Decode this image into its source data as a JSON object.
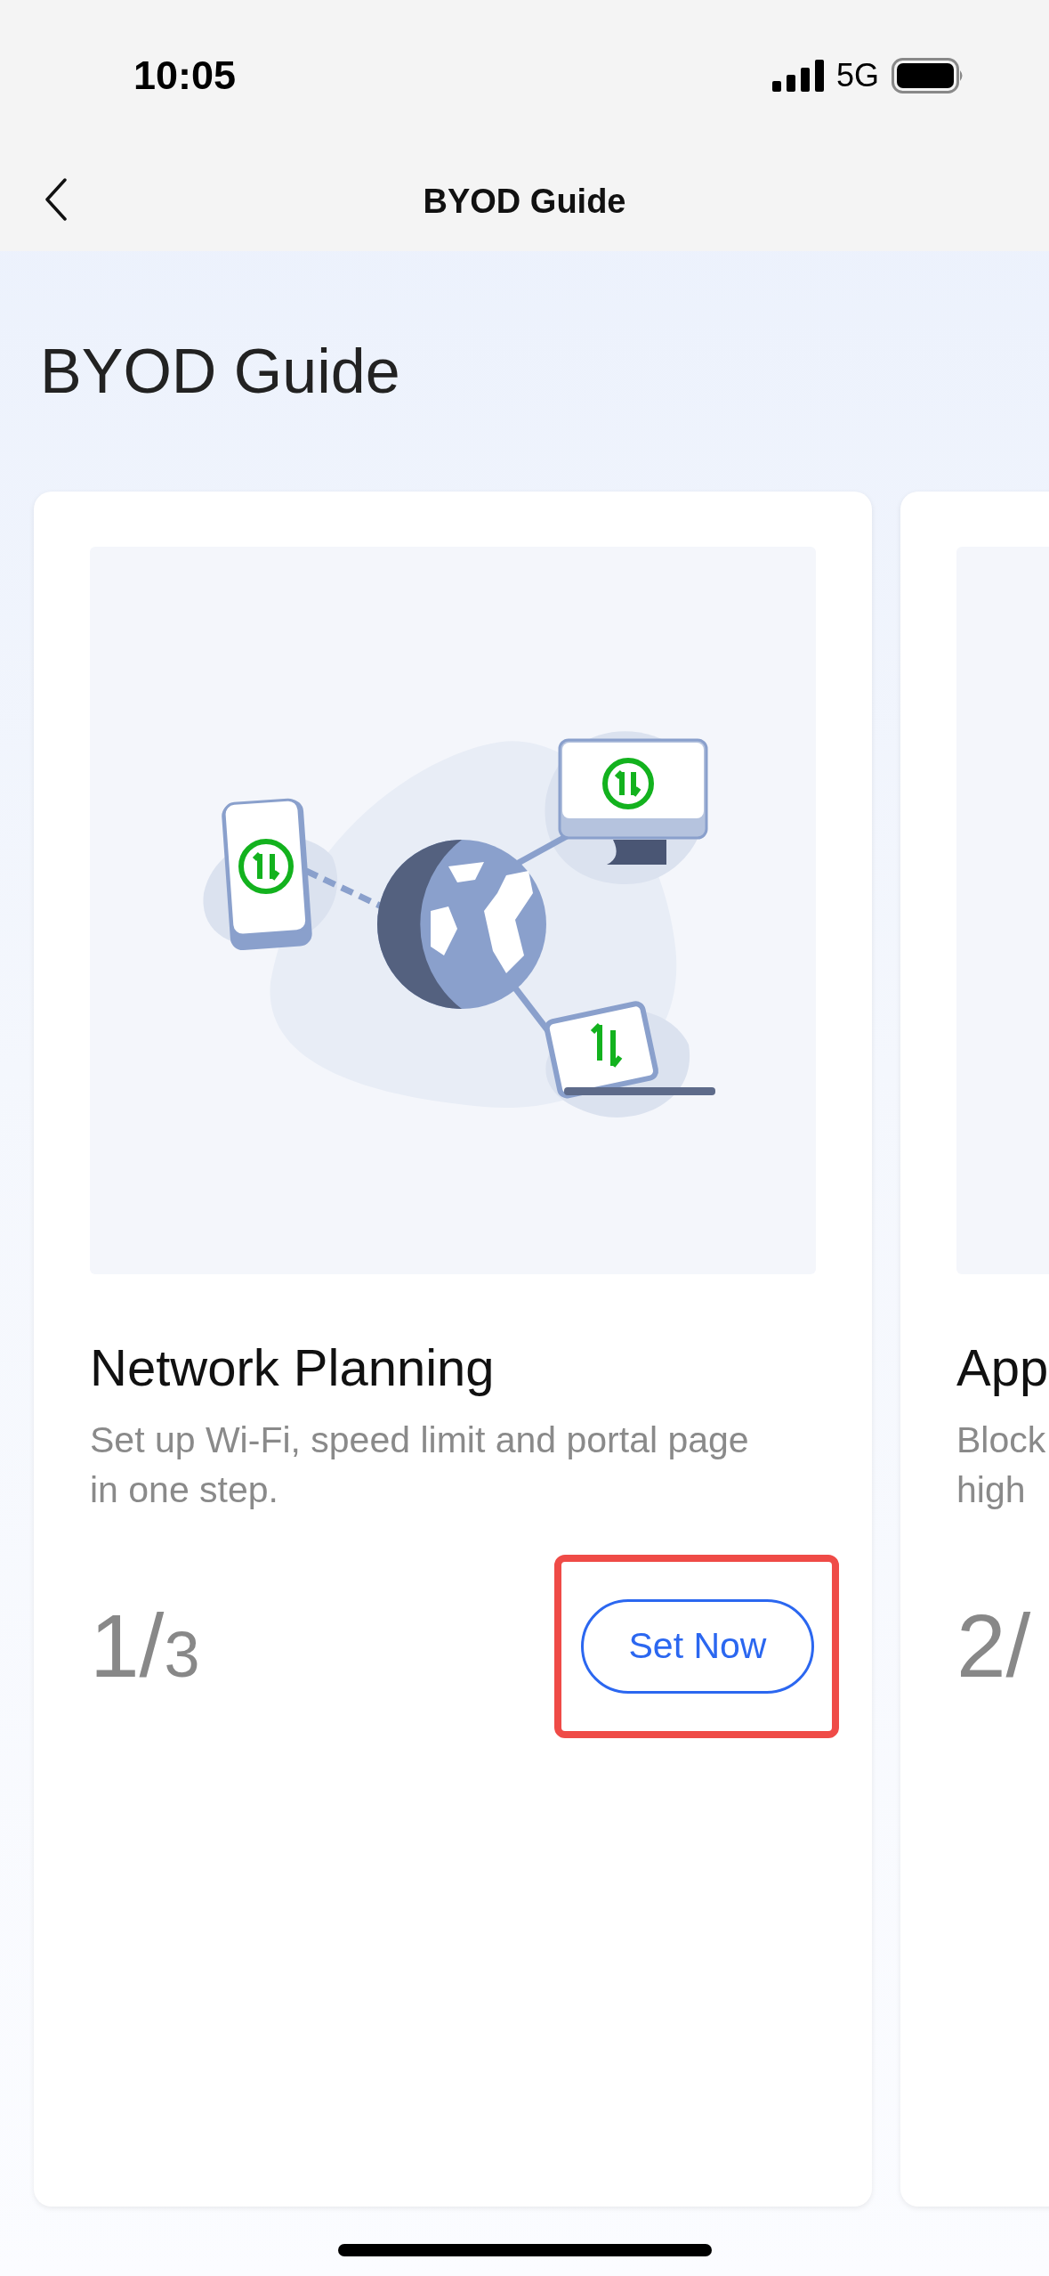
{
  "status_bar": {
    "time": "10:05",
    "network": "5G"
  },
  "nav_bar": {
    "title": "BYOD Guide"
  },
  "heading": "BYOD Guide",
  "cards": [
    {
      "title": "Network Planning",
      "description": "Set up Wi-Fi, speed limit and portal page in one step.",
      "counter_main": "1/",
      "counter_total": "3",
      "button": {
        "label": "Set Now",
        "highlighted": true
      },
      "kind": "network"
    },
    {
      "title": "App",
      "description": "Block\nhigh",
      "counter_main": "2/",
      "kind": "cropped"
    }
  ]
}
